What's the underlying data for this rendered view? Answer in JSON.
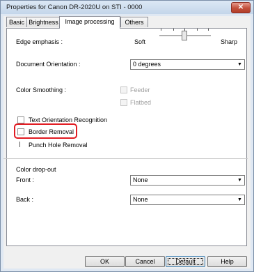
{
  "window": {
    "title": "Properties for Canon DR-2020U on STI - 0000",
    "close_glyph": "✕"
  },
  "tabs": [
    {
      "label": "Basic"
    },
    {
      "label": "Brightness"
    },
    {
      "label": "Image processing"
    },
    {
      "label": "Others"
    }
  ],
  "edge": {
    "label": "Edge emphasis :",
    "left": "Soft",
    "right": "Sharp",
    "level_fraction": 0.5
  },
  "orientation": {
    "label": "Document Orientation :",
    "value": "0 degrees"
  },
  "smoothing": {
    "label": "Color Smoothing :",
    "feeder": "Feeder",
    "flatbed": "Flatbed"
  },
  "text_orient": {
    "label": "Text Orientation Recognition"
  },
  "border_removal": {
    "label": "Border Removal"
  },
  "punch_hole": {
    "label": "Punch Hole Removal"
  },
  "dropout": {
    "label": "Color drop-out",
    "front_label": "Front :",
    "front_value": "None",
    "back_label": "Back :",
    "back_value": "None"
  },
  "buttons": {
    "ok": "OK",
    "cancel": "Cancel",
    "default": "Default",
    "help": "Help"
  },
  "colors": {
    "highlight": "#e11b22",
    "close": "#c24f3a"
  },
  "icons": [
    "close-icon",
    "chevron-down-icon"
  ]
}
